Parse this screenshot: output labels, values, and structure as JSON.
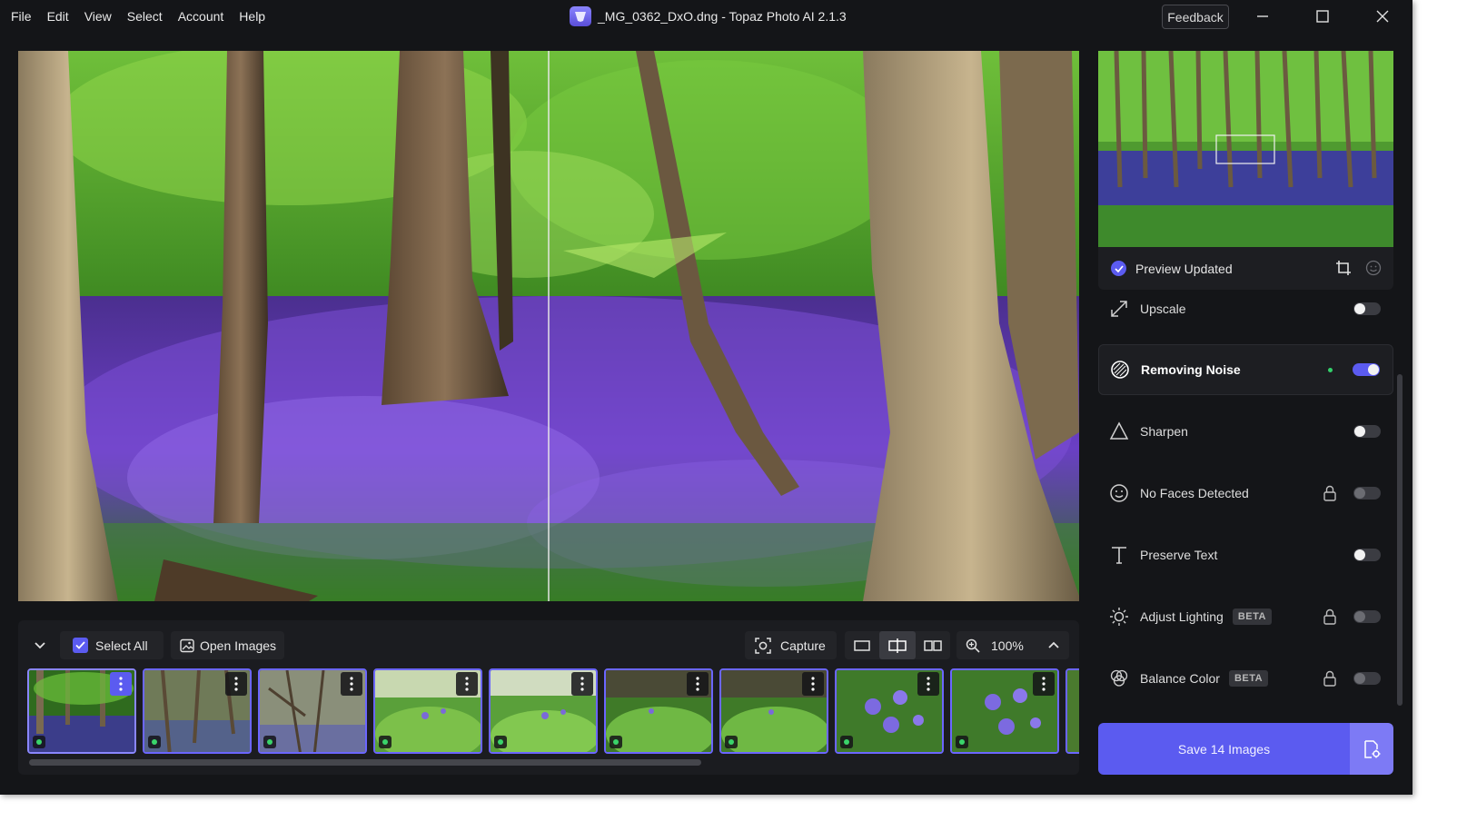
{
  "menu": [
    "File",
    "Edit",
    "View",
    "Select",
    "Account",
    "Help"
  ],
  "window": {
    "title": "_MG_0362_DxO.dng - Topaz Photo AI 2.1.3",
    "feedback_label": "Feedback"
  },
  "icons": {
    "minimize": "minimize-icon",
    "maximize": "maximize-icon",
    "close": "close-icon",
    "collapse": "chevron-down-icon",
    "zoom": "zoom-icon",
    "expand": "chevron-up-icon"
  },
  "toolbar": {
    "select_all_label": "Select All",
    "open_images_label": "Open Images",
    "capture_label": "Capture",
    "zoom_level": "100%"
  },
  "preview": {
    "status": "Preview Updated"
  },
  "features": [
    {
      "label": "Upscale",
      "enabled": false
    },
    {
      "label": "Removing Noise",
      "enabled": true
    },
    {
      "label": "Sharpen",
      "enabled": false
    },
    {
      "label": "No Faces Detected",
      "enabled": false,
      "locked": true
    },
    {
      "label": "Preserve Text",
      "enabled": false
    },
    {
      "label": "Adjust Lighting",
      "badge": "BETA",
      "enabled": false,
      "locked": true
    },
    {
      "label": "Balance Color",
      "badge": "BETA",
      "enabled": false,
      "locked": true
    }
  ],
  "save_label": "Save 14 Images",
  "thumbnail_count_visible": 9,
  "colors": {
    "accent": "#5b5bf0",
    "background": "#141518",
    "panel": "#1d1e22",
    "status_green": "#33d06a"
  }
}
